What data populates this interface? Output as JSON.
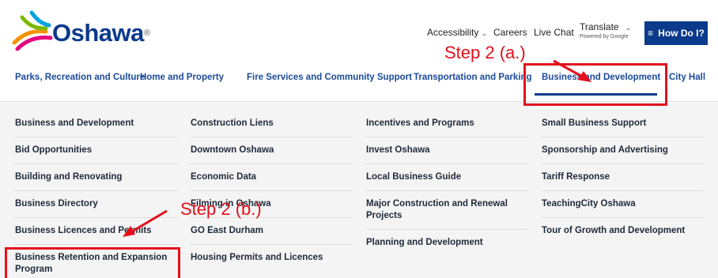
{
  "header": {
    "logo_text": "Oshawa",
    "logo_reg": "®",
    "utility_links": [
      "Accessibility",
      "Careers",
      "Live Chat"
    ],
    "translate_label": "Translate",
    "translate_powered": "Powered by Google",
    "how_do_i_label": "How Do I?"
  },
  "nav": {
    "items": [
      "Parks, Recreation and Culture",
      "Home and Property",
      "Fire Services and Community Support",
      "Transportation and Parking",
      "Business and Development",
      "City Hall"
    ],
    "active_index": 4
  },
  "menu": {
    "columns": [
      [
        "Business and Development",
        "Bid Opportunities",
        "Building and Renovating",
        "Business Directory",
        "Business Licences and Permits",
        "Business Retention and Expansion Program"
      ],
      [
        "Construction Liens",
        "Downtown Oshawa",
        "Economic Data",
        "Filming in Oshawa",
        "GO East Durham",
        "Housing Permits and Licences"
      ],
      [
        "Incentives and Programs",
        "Invest Oshawa",
        "Local Business Guide",
        "Major Construction and Renewal Projects",
        "Planning and Development"
      ],
      [
        "Small Business Support",
        "Sponsorship and Advertising",
        "Tariff Response",
        "TeachingCity Oshawa",
        "Tour of Growth and Development"
      ]
    ]
  },
  "annotations": {
    "step_a": "Step 2 (a.)",
    "step_b": "Step 2 (b.)",
    "color": "#e3101b"
  },
  "colors": {
    "brand_blue": "#0b3a8c",
    "nav_text": "#1b4a9a",
    "panel_bg": "#f4f4f4"
  }
}
